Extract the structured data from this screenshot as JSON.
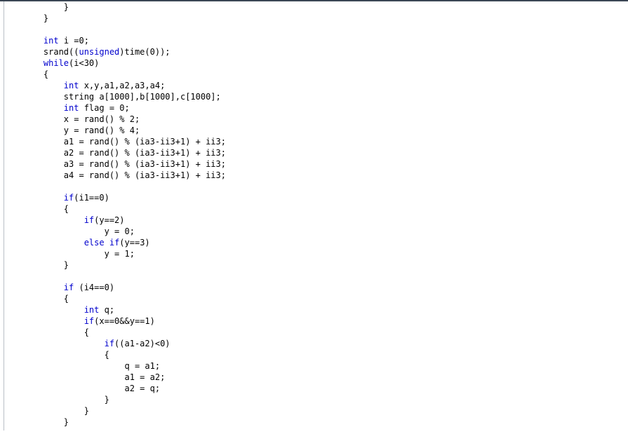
{
  "document": {
    "type": "source-code-listing",
    "language": "C++",
    "background_color": "#ffffff",
    "text_color": "#000000",
    "keyword_color": "#0000cd",
    "top_rule_color": "#3b4654",
    "left_rule_color": "#b9bfc6",
    "indent_unit_spaces": 4,
    "lines": [
      {
        "indent": 2,
        "tokens": [
          {
            "t": "}",
            "k": false
          }
        ]
      },
      {
        "indent": 1,
        "tokens": [
          {
            "t": "}",
            "k": false
          }
        ]
      },
      {
        "indent": 0,
        "tokens": [
          {
            "t": "",
            "k": false
          }
        ]
      },
      {
        "indent": 1,
        "tokens": [
          {
            "t": "int",
            "k": true
          },
          {
            "t": " i =0;",
            "k": false
          }
        ]
      },
      {
        "indent": 1,
        "tokens": [
          {
            "t": "srand((",
            "k": false
          },
          {
            "t": "unsigned",
            "k": true
          },
          {
            "t": ")time(0));",
            "k": false
          }
        ]
      },
      {
        "indent": 1,
        "tokens": [
          {
            "t": "while",
            "k": true
          },
          {
            "t": "(i<30)",
            "k": false
          }
        ]
      },
      {
        "indent": 1,
        "tokens": [
          {
            "t": "{",
            "k": false
          }
        ]
      },
      {
        "indent": 2,
        "tokens": [
          {
            "t": "int",
            "k": true
          },
          {
            "t": " x,y,a1,a2,a3,a4;",
            "k": false
          }
        ]
      },
      {
        "indent": 2,
        "tokens": [
          {
            "t": "string a[1000],b[1000],c[1000];",
            "k": false
          }
        ]
      },
      {
        "indent": 2,
        "tokens": [
          {
            "t": "int",
            "k": true
          },
          {
            "t": " flag = 0;",
            "k": false
          }
        ]
      },
      {
        "indent": 2,
        "tokens": [
          {
            "t": "x = rand() % 2;",
            "k": false
          }
        ]
      },
      {
        "indent": 2,
        "tokens": [
          {
            "t": "y = rand() % 4;",
            "k": false
          }
        ]
      },
      {
        "indent": 2,
        "tokens": [
          {
            "t": "a1 = rand() % (ia3-ii3+1) + ii3;",
            "k": false
          }
        ]
      },
      {
        "indent": 2,
        "tokens": [
          {
            "t": "a2 = rand() % (ia3-ii3+1) + ii3;",
            "k": false
          }
        ]
      },
      {
        "indent": 2,
        "tokens": [
          {
            "t": "a3 = rand() % (ia3-ii3+1) + ii3;",
            "k": false
          }
        ]
      },
      {
        "indent": 2,
        "tokens": [
          {
            "t": "a4 = rand() % (ia3-ii3+1) + ii3;",
            "k": false
          }
        ]
      },
      {
        "indent": 0,
        "tokens": [
          {
            "t": "",
            "k": false
          }
        ]
      },
      {
        "indent": 2,
        "tokens": [
          {
            "t": "if",
            "k": true
          },
          {
            "t": "(i1==0)",
            "k": false
          }
        ]
      },
      {
        "indent": 2,
        "tokens": [
          {
            "t": "{",
            "k": false
          }
        ]
      },
      {
        "indent": 3,
        "tokens": [
          {
            "t": "if",
            "k": true
          },
          {
            "t": "(y==2)",
            "k": false
          }
        ]
      },
      {
        "indent": 4,
        "tokens": [
          {
            "t": "y = 0;",
            "k": false
          }
        ]
      },
      {
        "indent": 3,
        "tokens": [
          {
            "t": "else",
            "k": true
          },
          {
            "t": " ",
            "k": false
          },
          {
            "t": "if",
            "k": true
          },
          {
            "t": "(y==3)",
            "k": false
          }
        ]
      },
      {
        "indent": 4,
        "tokens": [
          {
            "t": "y = 1;",
            "k": false
          }
        ]
      },
      {
        "indent": 2,
        "tokens": [
          {
            "t": "}",
            "k": false
          }
        ]
      },
      {
        "indent": 0,
        "tokens": [
          {
            "t": "",
            "k": false
          }
        ]
      },
      {
        "indent": 2,
        "tokens": [
          {
            "t": "if",
            "k": true
          },
          {
            "t": " (i4==0)",
            "k": false
          }
        ]
      },
      {
        "indent": 2,
        "tokens": [
          {
            "t": "{",
            "k": false
          }
        ]
      },
      {
        "indent": 3,
        "tokens": [
          {
            "t": "int",
            "k": true
          },
          {
            "t": " q;",
            "k": false
          }
        ]
      },
      {
        "indent": 3,
        "tokens": [
          {
            "t": "if",
            "k": true
          },
          {
            "t": "(x==0&&y==1)",
            "k": false
          }
        ]
      },
      {
        "indent": 3,
        "tokens": [
          {
            "t": "{",
            "k": false
          }
        ]
      },
      {
        "indent": 4,
        "tokens": [
          {
            "t": "if",
            "k": true
          },
          {
            "t": "((a1-a2)<0)",
            "k": false
          }
        ]
      },
      {
        "indent": 4,
        "tokens": [
          {
            "t": "{",
            "k": false
          }
        ]
      },
      {
        "indent": 5,
        "tokens": [
          {
            "t": "q = a1;",
            "k": false
          }
        ]
      },
      {
        "indent": 5,
        "tokens": [
          {
            "t": "a1 = a2;",
            "k": false
          }
        ]
      },
      {
        "indent": 5,
        "tokens": [
          {
            "t": "a2 = q;",
            "k": false
          }
        ]
      },
      {
        "indent": 4,
        "tokens": [
          {
            "t": "}",
            "k": false
          }
        ]
      },
      {
        "indent": 3,
        "tokens": [
          {
            "t": "}",
            "k": false
          }
        ]
      },
      {
        "indent": 2,
        "tokens": [
          {
            "t": "}",
            "k": false
          }
        ]
      }
    ]
  }
}
